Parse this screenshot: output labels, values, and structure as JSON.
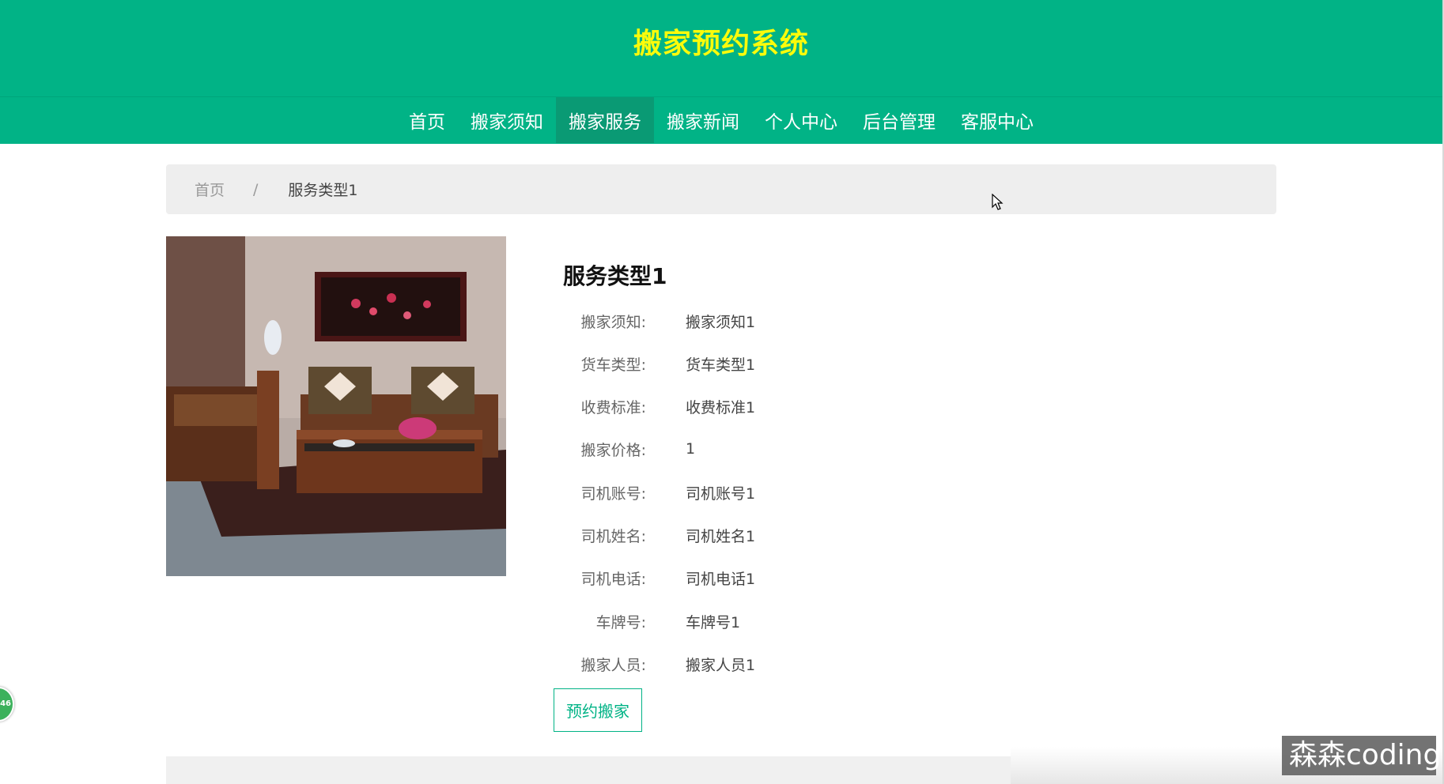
{
  "site": {
    "title": "搬家预约系统"
  },
  "nav": {
    "items": [
      "首页",
      "搬家须知",
      "搬家服务",
      "搬家新闻",
      "个人中心",
      "后台管理",
      "客服中心"
    ],
    "active": "搬家服务"
  },
  "breadcrumb": {
    "home": "首页",
    "separator": "/",
    "current": "服务类型1"
  },
  "detail": {
    "title": "服务类型1",
    "fields": [
      {
        "label": "搬家须知:",
        "value": "搬家须知1"
      },
      {
        "label": "货车类型:",
        "value": "货车类型1"
      },
      {
        "label": "收费标准:",
        "value": "收费标准1"
      },
      {
        "label": "搬家价格:",
        "value": "1"
      },
      {
        "label": "司机账号:",
        "value": "司机账号1"
      },
      {
        "label": "司机姓名:",
        "value": "司机姓名1"
      },
      {
        "label": "司机电话:",
        "value": "司机电话1"
      },
      {
        "label": "车牌号:",
        "value": "车牌号1"
      },
      {
        "label": "搬家人员:",
        "value": "搬家人员1"
      }
    ],
    "book_button": "预约搬家"
  },
  "badge": {
    "text": "46"
  },
  "watermark": {
    "text": "森森coding"
  },
  "colors": {
    "header": "#01b386",
    "title": "#fbfb0b",
    "nav_active": "#0a9a74"
  }
}
